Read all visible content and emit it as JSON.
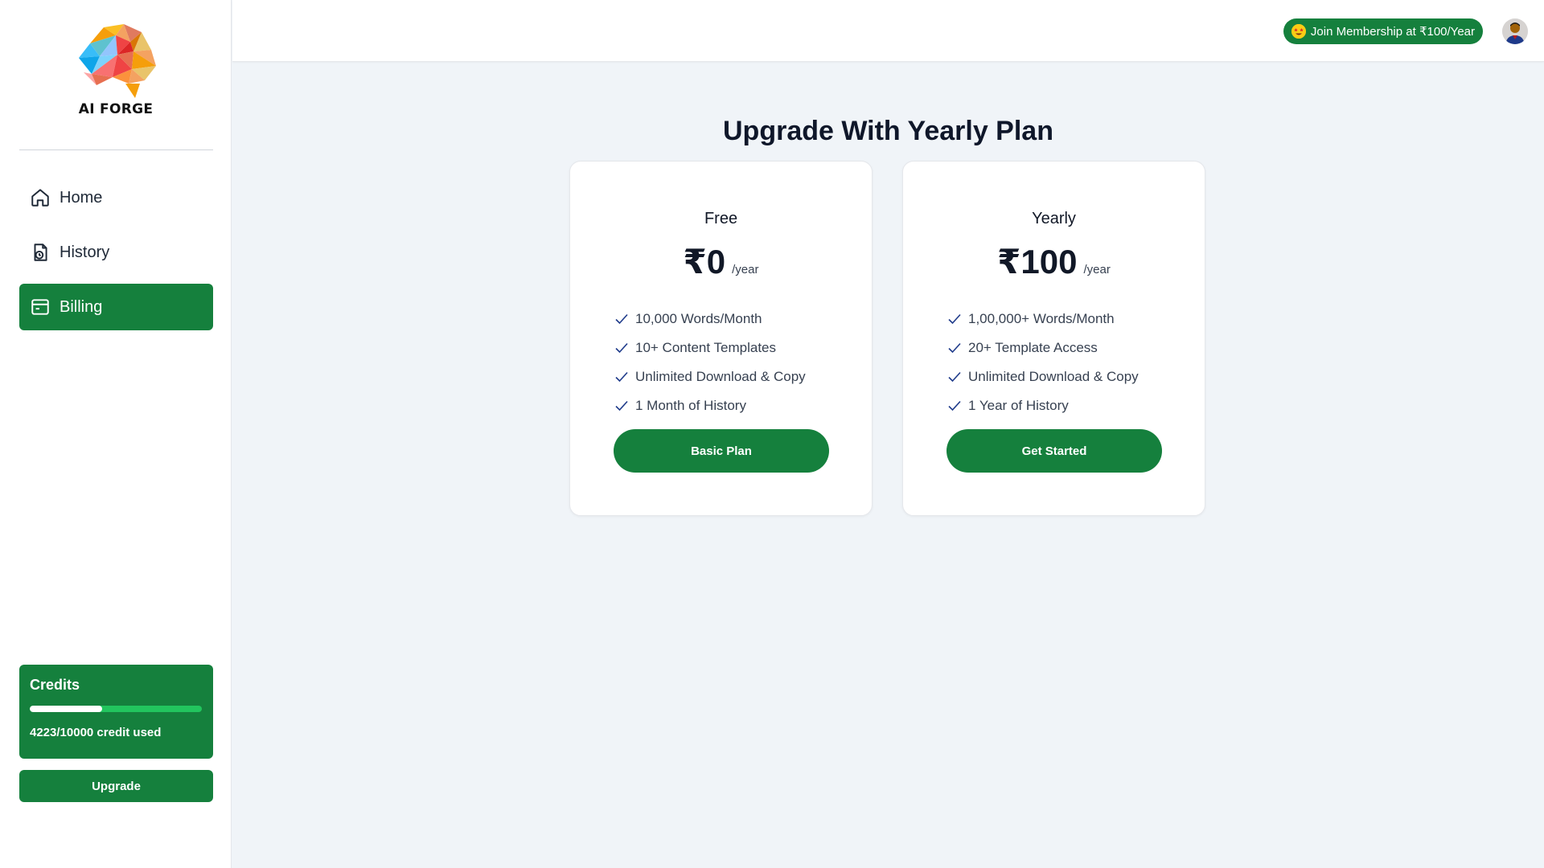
{
  "brand": {
    "name": "AI FORGE",
    "logo_icon": "brain-logo-icon"
  },
  "sidebar": {
    "items": [
      {
        "label": "Home",
        "icon": "home-icon",
        "active": false
      },
      {
        "label": "History",
        "icon": "history-icon",
        "active": false
      },
      {
        "label": "Billing",
        "icon": "billing-icon",
        "active": true
      }
    ],
    "credits": {
      "title": "Credits",
      "used": 4223,
      "total": 10000,
      "fraction_used": 0.4223,
      "text": "4223/10000 credit used"
    },
    "upgrade_label": "Upgrade"
  },
  "header": {
    "membership_label": "Join Membership at ₹100/Year",
    "membership_icon": "star-struck-emoji-icon",
    "avatar_icon": "user-avatar"
  },
  "main": {
    "title": "Upgrade With Yearly Plan",
    "plans": [
      {
        "name": "Free",
        "price": "₹0",
        "period": "/year",
        "features": [
          "10,000 Words/Month",
          "10+ Content Templates",
          "Unlimited Download & Copy",
          "1 Month of History"
        ],
        "button_label": "Basic Plan"
      },
      {
        "name": "Yearly",
        "price": "₹100",
        "period": "/year",
        "features": [
          "1,00,000+ Words/Month",
          "20+ Template Access",
          "Unlimited Download & Copy",
          "1 Year of History"
        ],
        "button_label": "Get Started"
      }
    ]
  },
  "colors": {
    "accent": "#15803d",
    "progress_track": "#22c55e",
    "background": "#f0f4f8",
    "check": "#1e3a8a"
  }
}
